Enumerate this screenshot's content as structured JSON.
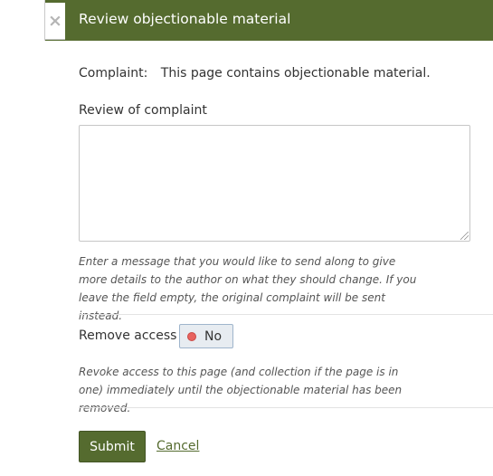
{
  "modal": {
    "close_glyph": "×",
    "title": "Review objectionable material"
  },
  "complaint": {
    "label": "Complaint:",
    "text": "This page contains objectionable material."
  },
  "review": {
    "label": "Review of complaint",
    "value": "",
    "placeholder": "",
    "help": "Enter a message that you would like to send along to give more details to the author on what they should change. If you leave the field empty, the original complaint will be sent instead."
  },
  "remove_access": {
    "label": "Remove access",
    "toggle_text": "No",
    "toggle_state": false,
    "help": "Revoke access to this page (and collection if the page is in one) immediately until the objectionable material has been removed."
  },
  "actions": {
    "submit_label": "Submit",
    "cancel_label": "Cancel"
  },
  "colors": {
    "header": "#556b2f",
    "toggle_off_dot": "#e8635f",
    "link": "#556b2f"
  }
}
